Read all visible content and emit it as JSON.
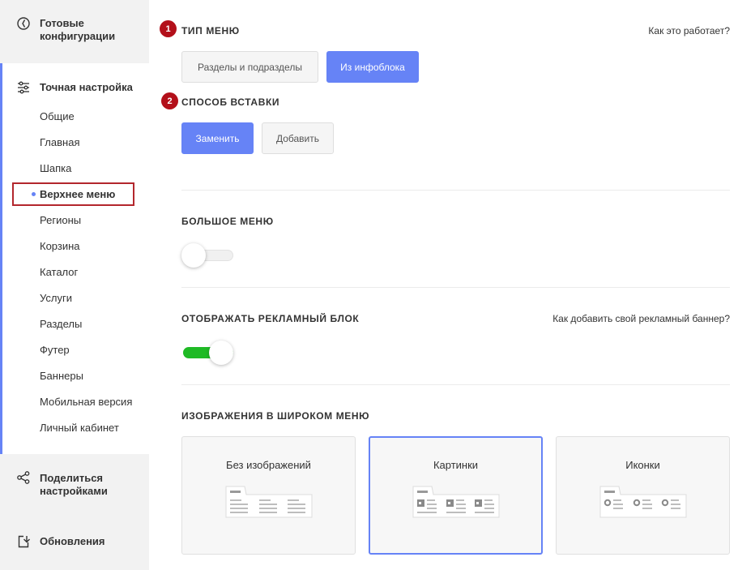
{
  "sidebar": {
    "top_block": {
      "label": "Готовые конфигурации",
      "icon": "configurations-icon"
    },
    "active_section": {
      "label": "Точная настройка",
      "icon": "sliders-icon",
      "items": [
        {
          "label": "Общие"
        },
        {
          "label": "Главная"
        },
        {
          "label": "Шапка"
        },
        {
          "label": "Верхнее меню",
          "selected": true
        },
        {
          "label": "Регионы"
        },
        {
          "label": "Корзина"
        },
        {
          "label": "Каталог"
        },
        {
          "label": "Услуги"
        },
        {
          "label": "Разделы"
        },
        {
          "label": "Футер"
        },
        {
          "label": "Баннеры"
        },
        {
          "label": "Мобильная версия"
        },
        {
          "label": "Личный кабинет"
        }
      ]
    },
    "share_block": {
      "label": "Поделиться настройками",
      "icon": "share-icon"
    },
    "updates_block": {
      "label": "Обновления",
      "icon": "updates-icon"
    }
  },
  "main": {
    "menu_type": {
      "badge": "1",
      "title": "ТИП МЕНЮ",
      "help": "Как это работает?",
      "options": [
        {
          "label": "Разделы и подразделы",
          "active": false
        },
        {
          "label": "Из инфоблока",
          "active": true
        }
      ]
    },
    "insert_method": {
      "badge": "2",
      "title": "СПОСОБ ВСТАВКИ",
      "options": [
        {
          "label": "Заменить",
          "active": true
        },
        {
          "label": "Добавить",
          "active": false
        }
      ]
    },
    "big_menu": {
      "title": "БОЛЬШОЕ МЕНЮ",
      "enabled": false
    },
    "ad_block": {
      "title": "ОТОБРАЖАТЬ РЕКЛАМНЫЙ БЛОК",
      "help": "Как добавить свой рекламный баннер?",
      "enabled": true
    },
    "wide_menu_images": {
      "title": "ИЗОБРАЖЕНИЯ В ШИРОКОМ МЕНЮ",
      "cards": [
        {
          "label": "Без изображений",
          "selected": false
        },
        {
          "label": "Картинки",
          "selected": true
        },
        {
          "label": "Иконки",
          "selected": false
        }
      ]
    }
  },
  "colors": {
    "accent": "#6683f6",
    "toggle_on": "#1fba25",
    "badge": "#b3101a",
    "highlight_border": "#b3272d"
  }
}
